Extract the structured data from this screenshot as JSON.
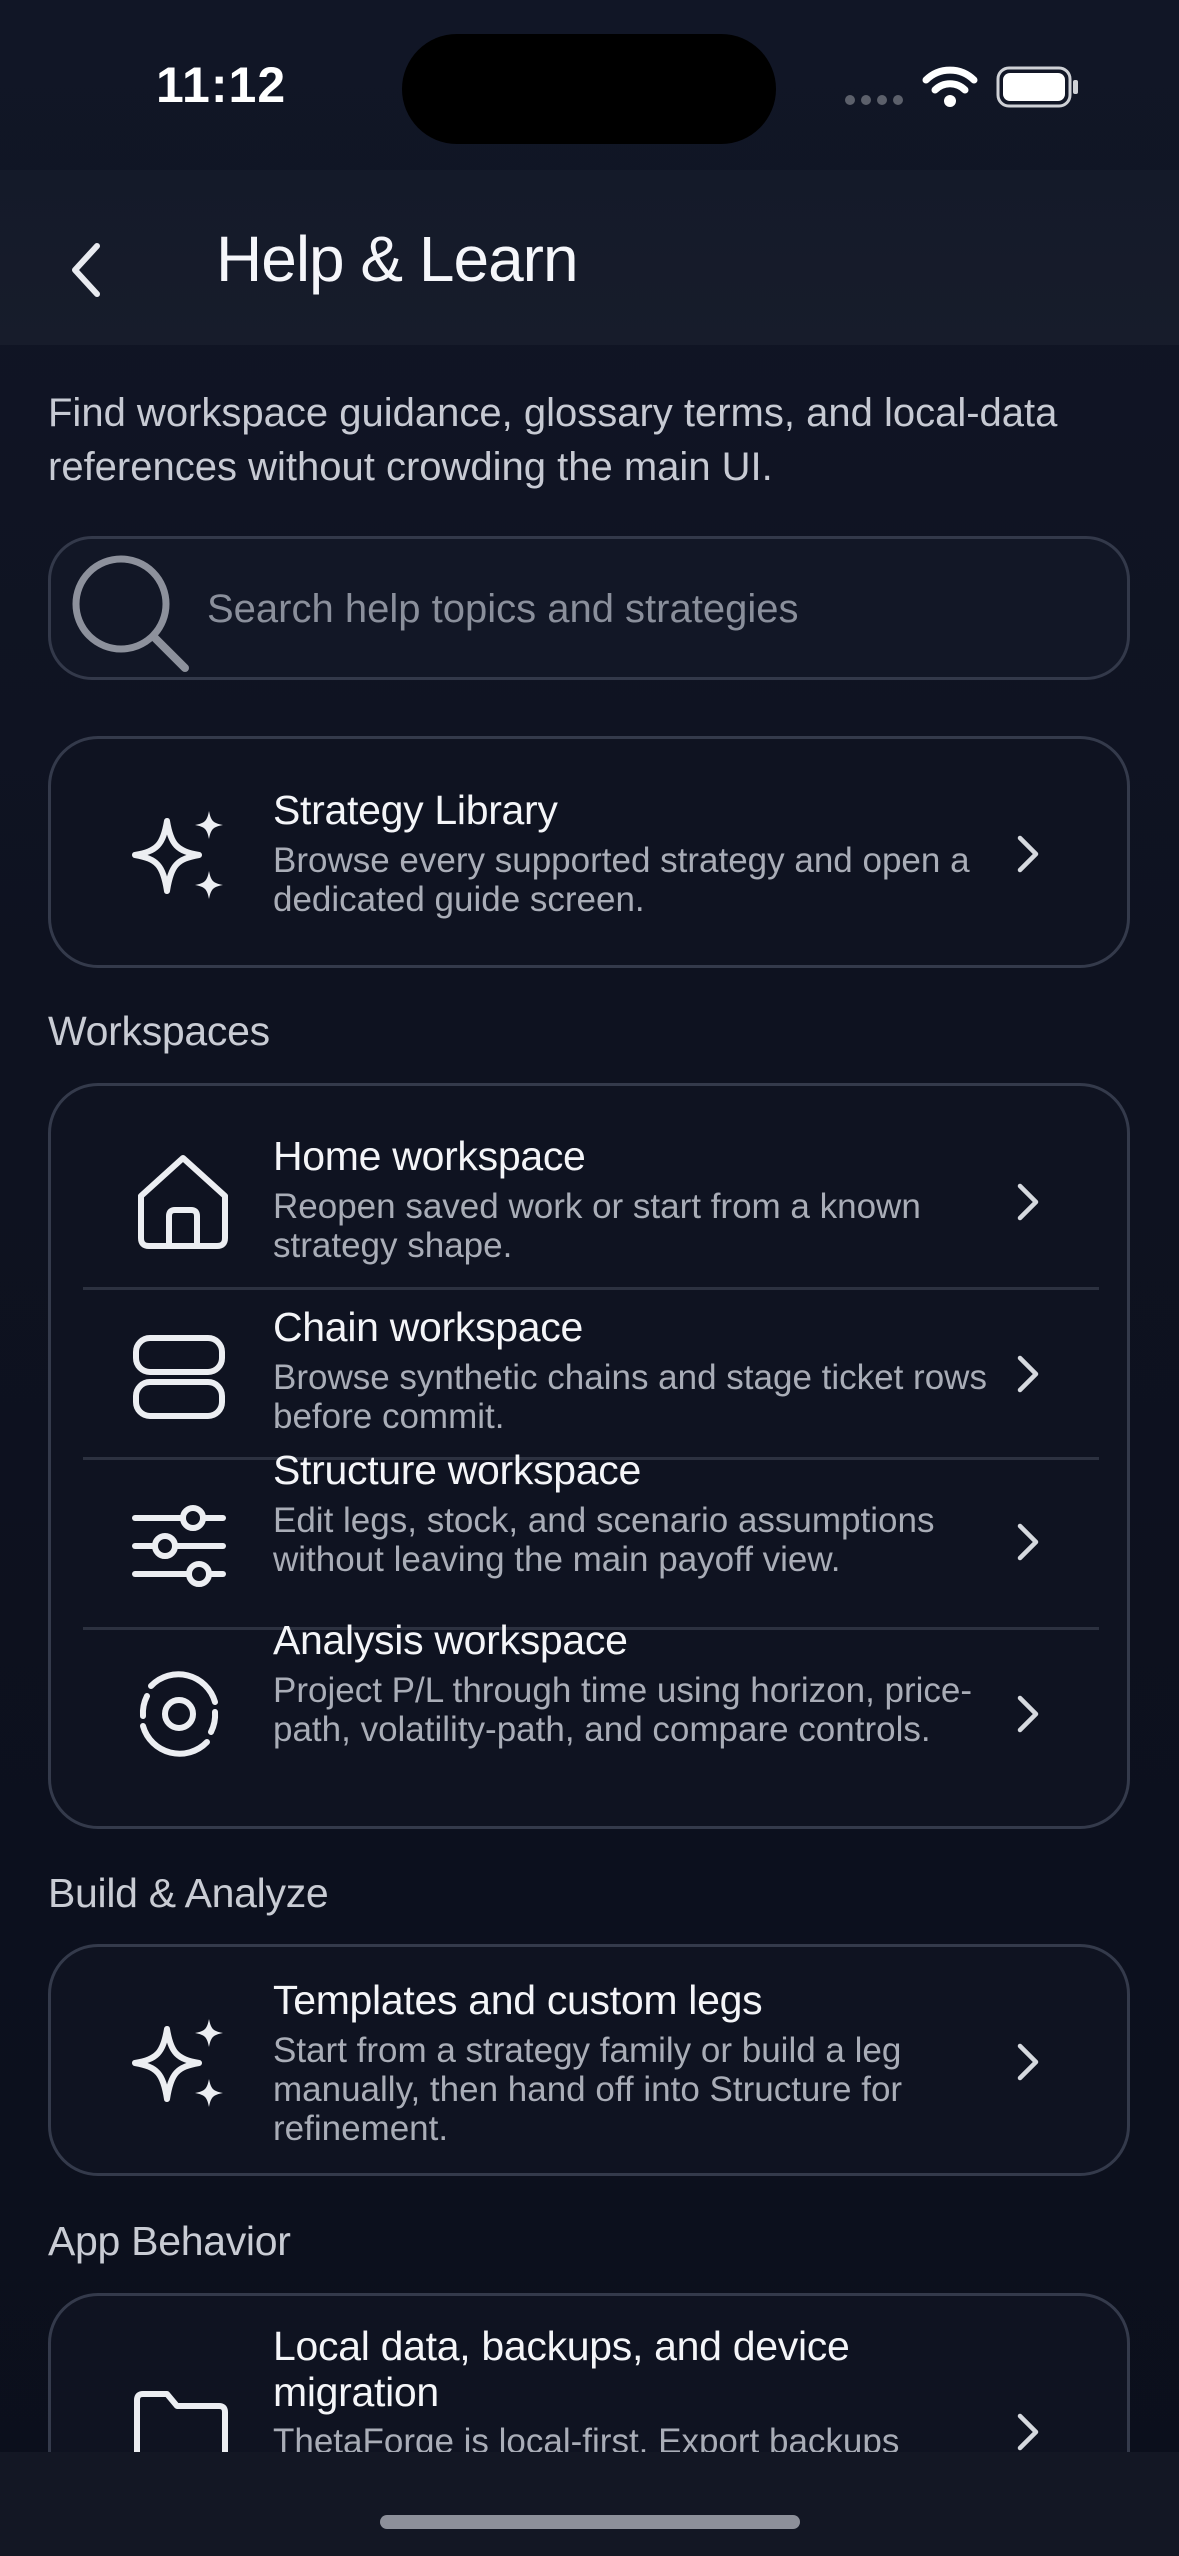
{
  "status": {
    "time": "11:12"
  },
  "header": {
    "title": "Help & Learn"
  },
  "intro": "Find workspace guidance, glossary terms, and local-data references without crowding the main UI.",
  "search": {
    "placeholder": "Search help topics and strategies"
  },
  "featured": {
    "title": "Strategy Library",
    "desc": "Browse every supported strategy and open a dedicated guide screen.",
    "icon": "sparkles-icon"
  },
  "sections": {
    "workspaces": {
      "label": "Workspaces",
      "items": [
        {
          "title": "Home workspace",
          "desc": "Reopen saved work or start from a known strategy shape.",
          "icon": "home-icon"
        },
        {
          "title": "Chain workspace",
          "desc": "Browse synthetic chains and stage ticket rows before commit.",
          "icon": "stack-icon"
        },
        {
          "title": "Structure workspace",
          "desc": "Edit legs, stock, and scenario assumptions without leaving the main payoff view.",
          "icon": "sliders-icon"
        },
        {
          "title": "Analysis workspace",
          "desc": "Project P/L through time using horizon, price-path, volatility-path, and compare controls.",
          "icon": "orbit-icon"
        }
      ]
    },
    "build": {
      "label": "Build & Analyze",
      "items": [
        {
          "title": "Templates and custom legs",
          "desc": "Start from a strategy family or build a leg manually, then hand off into Structure for refinement.",
          "icon": "sparkles-icon"
        }
      ]
    },
    "app": {
      "label": "App Behavior",
      "items": [
        {
          "title": "Local data, backups, and device migration",
          "desc": "ThetaForge is local-first. Export backups",
          "icon": "folder-icon"
        }
      ]
    }
  },
  "colors": {
    "background": "#0e1220",
    "card_border": "#343a4b",
    "text_primary": "#f4f5f8",
    "text_secondary": "#a9adb7"
  }
}
